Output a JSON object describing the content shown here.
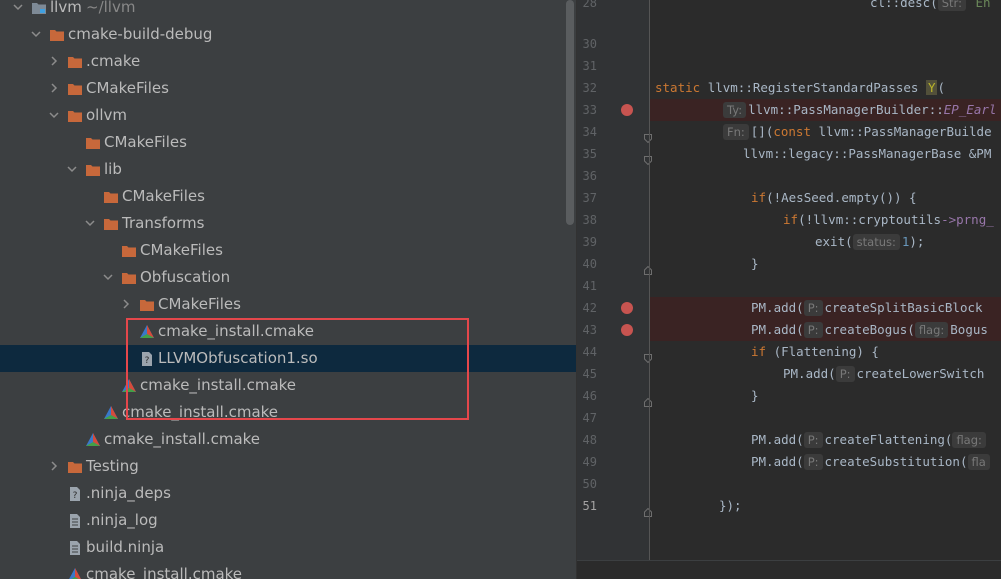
{
  "tree": {
    "rows": [
      {
        "label": "llvm",
        "sub": "~/llvm",
        "icon": "module",
        "chevron": "down"
      },
      {
        "label": "cmake-build-debug",
        "icon": "folder",
        "chevron": "down"
      },
      {
        "label": ".cmake",
        "icon": "folder",
        "chevron": "right"
      },
      {
        "label": "CMakeFiles",
        "icon": "folder",
        "chevron": "right"
      },
      {
        "label": "ollvm",
        "icon": "folder",
        "chevron": "down"
      },
      {
        "label": "CMakeFiles",
        "icon": "folder",
        "chevron": "none"
      },
      {
        "label": "lib",
        "icon": "folder",
        "chevron": "down"
      },
      {
        "label": "CMakeFiles",
        "icon": "folder",
        "chevron": "none"
      },
      {
        "label": "Transforms",
        "icon": "folder",
        "chevron": "down"
      },
      {
        "label": "CMakeFiles",
        "icon": "folder",
        "chevron": "none"
      },
      {
        "label": "Obfuscation",
        "icon": "folder",
        "chevron": "down"
      },
      {
        "label": "CMakeFiles",
        "icon": "folder",
        "chevron": "right"
      },
      {
        "label": "cmake_install.cmake",
        "icon": "cmake",
        "chevron": "none"
      },
      {
        "label": "LLVMObfuscation1.so",
        "icon": "unknown-file",
        "chevron": "none",
        "selected": true
      },
      {
        "label": "cmake_install.cmake",
        "icon": "cmake",
        "chevron": "none"
      },
      {
        "label": "cmake_install.cmake",
        "icon": "cmake",
        "chevron": "none"
      },
      {
        "label": "cmake_install.cmake",
        "icon": "cmake",
        "chevron": "none"
      },
      {
        "label": "Testing",
        "icon": "folder",
        "chevron": "right"
      },
      {
        "label": ".ninja_deps",
        "icon": "unknown-file",
        "chevron": "none"
      },
      {
        "label": ".ninja_log",
        "icon": "text-file",
        "chevron": "none"
      },
      {
        "label": "build.ninja",
        "icon": "text-file",
        "chevron": "none"
      },
      {
        "label": "cmake_install.cmake",
        "icon": "cmake",
        "chevron": "none"
      }
    ]
  },
  "editor": {
    "lines": [
      {
        "num": "28"
      },
      {
        "num": "30"
      },
      {
        "num": "31"
      },
      {
        "num": "32"
      },
      {
        "num": "33",
        "breakpoint": true
      },
      {
        "num": "34"
      },
      {
        "num": "35"
      },
      {
        "num": "36"
      },
      {
        "num": "37"
      },
      {
        "num": "38"
      },
      {
        "num": "39"
      },
      {
        "num": "40"
      },
      {
        "num": "41"
      },
      {
        "num": "42",
        "breakpoint": true
      },
      {
        "num": "43",
        "breakpoint": true
      },
      {
        "num": "44"
      },
      {
        "num": "45"
      },
      {
        "num": "46"
      },
      {
        "num": "47"
      },
      {
        "num": "48"
      },
      {
        "num": "49"
      },
      {
        "num": "50"
      },
      {
        "num": "51",
        "active": true
      }
    ],
    "code": {
      "l28": "cl::desc(",
      "l28_hint": "Str:",
      "l28_tail": "En",
      "l32_kw": "static ",
      "l32_rest": "llvm::RegisterStandardPasses ",
      "l32_y": "Y",
      "l32_paren": "(",
      "l33_hint": "Ty:",
      "l33_rest": "llvm::PassManagerBuilder::",
      "l33_it": "EP_Earl",
      "l34_hint": "Fn:",
      "l34_a": "[](",
      "l34_kw": "const ",
      "l34_b": "llvm::PassManagerBuilde",
      "l35": "llvm::legacy::PassManagerBase &PM",
      "l37_kw": "if",
      "l37_rest": "(!AesSeed.empty()) {",
      "l38_kw": "if",
      "l38_a": "(!llvm::cryptoutils",
      "l38_b": "->prng_",
      "l39_a": "exit(",
      "l39_hint": "status:",
      "l39_num": "1",
      "l39_b": ");",
      "l40": "}",
      "l42_a": "PM.add(",
      "l42_hint": "P:",
      "l42_fn": "createSplitBasicBlock",
      "l43_a": "PM.add(",
      "l43_hint": "P:",
      "l43_fn": "createBogus(",
      "l43_hint2": "flag:",
      "l43_b": "Bogus",
      "l44_kw": "if",
      "l44_rest": " (Flattening) {",
      "l45_a": "PM.add(",
      "l45_hint": "P:",
      "l45_fn": "createLowerSwitch",
      "l46": "}",
      "l48_a": "PM.add(",
      "l48_hint": "P:",
      "l48_fn": "createFlattening(",
      "l48_hint2": "flag:",
      "l49_a": "PM.add(",
      "l49_hint": "P:",
      "l49_fn": "createSubstitution(",
      "l49_hint2": "fla",
      "l51": "});"
    }
  }
}
